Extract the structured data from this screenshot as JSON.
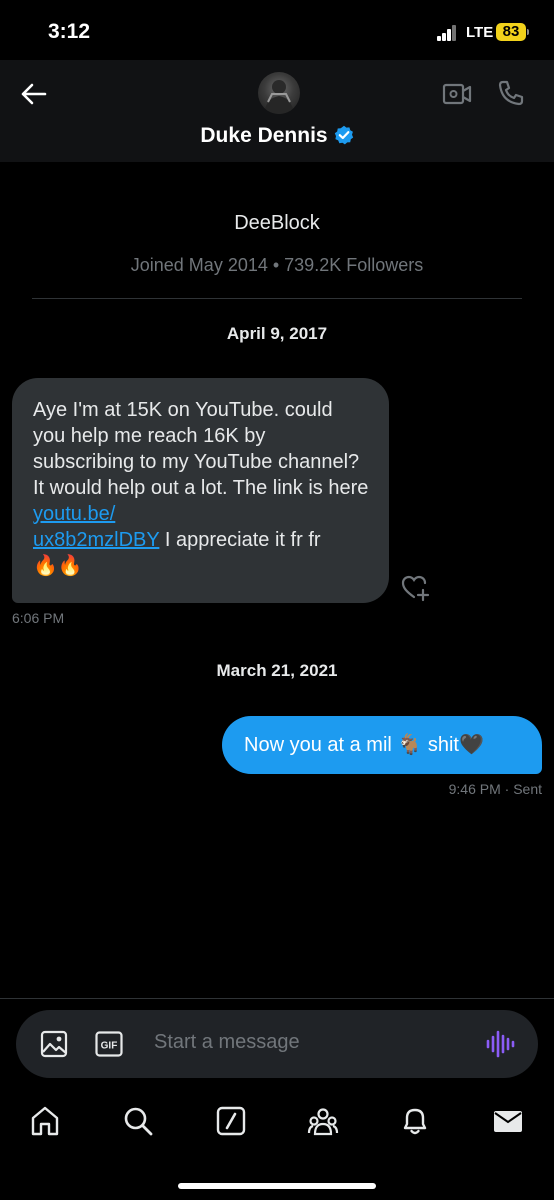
{
  "status_bar": {
    "time": "3:12",
    "network": "LTE",
    "battery": "83"
  },
  "header": {
    "contact_name": "Duke Dennis",
    "icons": [
      "back-arrow-icon",
      "avatar",
      "verified-badge-icon",
      "video-call-icon",
      "phone-icon"
    ]
  },
  "profile": {
    "handle": "DeeBlock",
    "meta": "Joined May 2014 • 739.2K Followers"
  },
  "conversation": {
    "sections": [
      {
        "date": "April 9, 2017",
        "message": {
          "direction": "incoming",
          "text_before_link": "Aye I'm at 15K on YouTube. could you help me reach 16K by subscribing to my YouTube channel? It would help out a lot. The link is here ",
          "link_line1": "youtu.be/",
          "link_line2": "ux8b2mzlDBY",
          "text_after_link": " I appreciate it fr fr",
          "emojis": "🔥🔥",
          "time": "6:06 PM"
        }
      },
      {
        "date": "March 21, 2021",
        "message": {
          "direction": "outgoing",
          "text": "Now you at a mil 🐐 shit🖤",
          "time": "9:46 PM · Sent"
        }
      }
    ]
  },
  "composer": {
    "placeholder": "Start a message",
    "gif_label": "GIF"
  },
  "bottom_nav": {
    "items": [
      "home-icon",
      "search-icon",
      "grok-icon",
      "communities-icon",
      "notifications-icon",
      "messages-icon"
    ],
    "active": "messages-icon"
  },
  "colors": {
    "accent": "#1d9bf0",
    "incoming_bubble": "#2f3336",
    "voice_accent": "#8b5cf6",
    "battery": "#f2d21b"
  }
}
